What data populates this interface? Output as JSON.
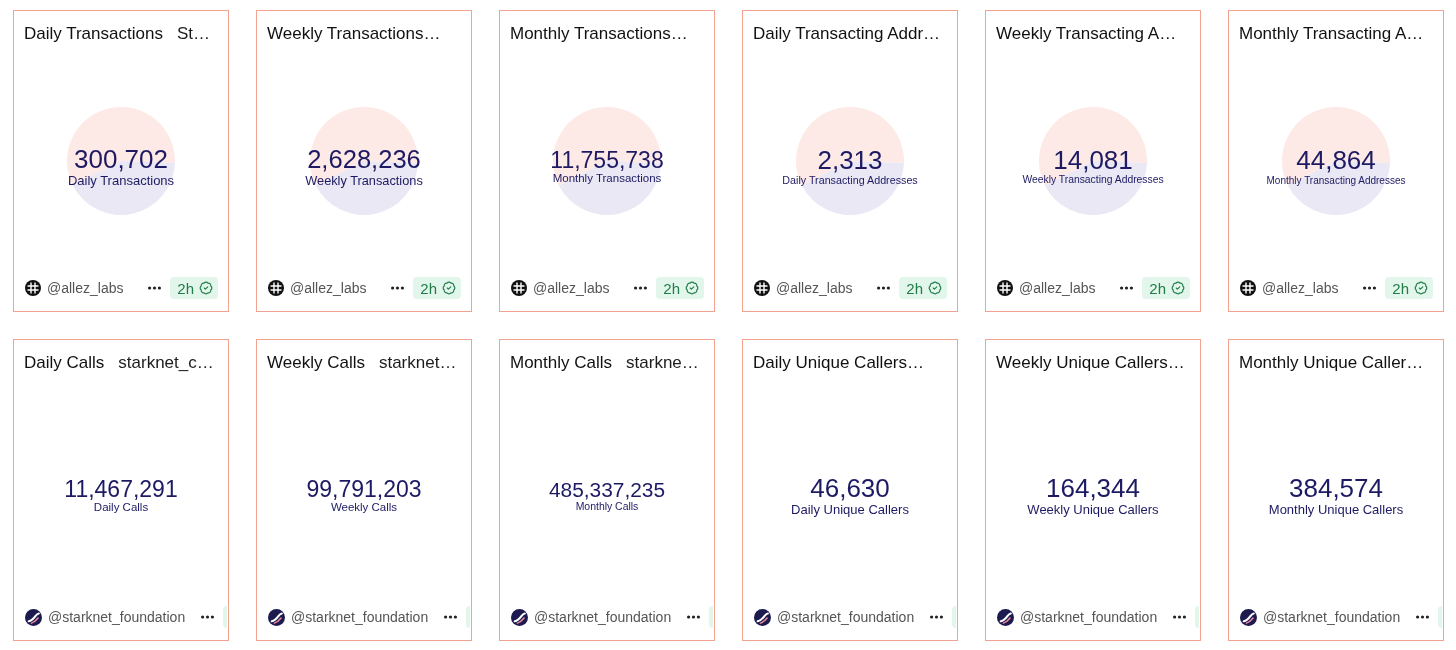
{
  "cards": [
    {
      "kind": "pie",
      "title": "Daily Transactions",
      "subtitle": "St…",
      "value": "300,702",
      "label": "Daily Transactions",
      "author": {
        "kind": "grid",
        "handle": "@allez_labs"
      },
      "badge": {
        "text": "2h",
        "verified": true,
        "clipped": false
      }
    },
    {
      "kind": "pie",
      "title": "Weekly Transactions…",
      "value": "2,628,236",
      "label": "Weekly Transactions",
      "author": {
        "kind": "grid",
        "handle": "@allez_labs"
      },
      "badge": {
        "text": "2h",
        "verified": true,
        "clipped": false
      }
    },
    {
      "kind": "pie",
      "title": "Monthly Transactions…",
      "value": "11,755,738",
      "label": "Monthly Transactions",
      "author": {
        "kind": "grid",
        "handle": "@allez_labs"
      },
      "badge": {
        "text": "2h",
        "verified": true,
        "clipped": false
      }
    },
    {
      "kind": "pie",
      "title": "Daily Transacting Addr…",
      "value": "2,313",
      "label": "Daily Transacting Addresses",
      "author": {
        "kind": "grid",
        "handle": "@allez_labs"
      },
      "badge": {
        "text": "2h",
        "verified": true,
        "clipped": false
      }
    },
    {
      "kind": "pie",
      "title": "Weekly Transacting A…",
      "value": "14,081",
      "label": "Weekly Transacting Addresses",
      "author": {
        "kind": "grid",
        "handle": "@allez_labs"
      },
      "badge": {
        "text": "2h",
        "verified": true,
        "clipped": false
      }
    },
    {
      "kind": "pie",
      "title": "Monthly Transacting A…",
      "value": "44,864",
      "label": "Monthly Transacting Addresses",
      "author": {
        "kind": "grid",
        "handle": "@allez_labs"
      },
      "badge": {
        "text": "2h",
        "verified": true,
        "clipped": false
      }
    },
    {
      "kind": "plain",
      "title": "Daily Calls",
      "subtitle": "starknet_c…",
      "value": "11,467,291",
      "label": "Daily Calls",
      "author": {
        "kind": "swoosh",
        "handle": "@starknet_foundation"
      },
      "badge": {
        "clipped": true
      }
    },
    {
      "kind": "plain",
      "title": "Weekly Calls",
      "subtitle": "starknet…",
      "value": "99,791,203",
      "label": "Weekly Calls",
      "author": {
        "kind": "swoosh",
        "handle": "@starknet_foundation"
      },
      "badge": {
        "clipped": true
      }
    },
    {
      "kind": "plain",
      "title": "Monthly Calls",
      "subtitle": "starkne…",
      "value": "485,337,235",
      "label": "Monthly Calls",
      "author": {
        "kind": "swoosh",
        "handle": "@starknet_foundation"
      },
      "badge": {
        "clipped": true
      }
    },
    {
      "kind": "plain",
      "title": "Daily Unique Callers…",
      "value": "46,630",
      "label": "Daily Unique Callers",
      "author": {
        "kind": "swoosh",
        "handle": "@starknet_foundation"
      },
      "badge": {
        "clipped": true
      }
    },
    {
      "kind": "plain",
      "title": "Weekly Unique Callers…",
      "value": "164,344",
      "label": "Weekly Unique Callers",
      "author": {
        "kind": "swoosh",
        "handle": "@starknet_foundation"
      },
      "badge": {
        "clipped": true
      }
    },
    {
      "kind": "plain",
      "title": "Monthly Unique Caller…",
      "value": "384,574",
      "label": "Monthly Unique Callers",
      "author": {
        "kind": "swoosh",
        "handle": "@starknet_foundation"
      },
      "badge": {
        "clipped": true
      }
    }
  ]
}
